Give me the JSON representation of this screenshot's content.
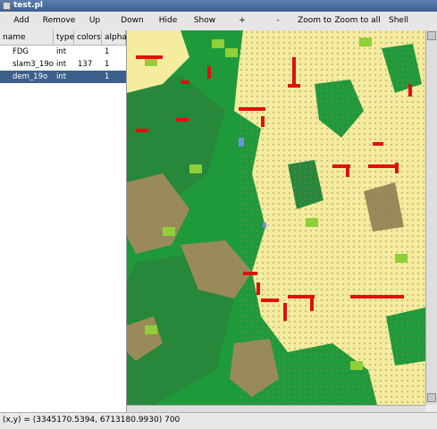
{
  "window": {
    "title": "test.pl"
  },
  "toolbar": {
    "buttons": [
      {
        "label": "Add"
      },
      {
        "label": "Remove"
      },
      {
        "label": "Up"
      },
      {
        "label": "Down"
      },
      {
        "label": "Hide"
      },
      {
        "label": "Show"
      },
      {
        "label": "+"
      },
      {
        "label": "-"
      },
      {
        "label": "Zoom to"
      },
      {
        "label": "Zoom to all"
      },
      {
        "label": "Shell"
      }
    ]
  },
  "layers": {
    "headers": [
      "name",
      "type",
      "colors",
      "alpha"
    ],
    "rows": [
      {
        "name": "FDG",
        "type": "int",
        "colors": "",
        "alpha": "1",
        "selected": false
      },
      {
        "name": "slam3_19o",
        "type": "int",
        "colors": "137",
        "alpha": "1",
        "selected": false
      },
      {
        "name": "dem_19o",
        "type": "int",
        "colors": "",
        "alpha": "1",
        "selected": true
      }
    ]
  },
  "map": {
    "palette": {
      "cream": "#f6ec9e",
      "green": "#1f9a3a",
      "darkgreen": "#27873a",
      "brown": "#9a8a5a",
      "lightgreen": "#8fcf3a",
      "red": "#e01010",
      "blue": "#7090e0"
    }
  },
  "status": {
    "text": "(x,y) = (3345170.5394, 6713180.9930) 700"
  }
}
